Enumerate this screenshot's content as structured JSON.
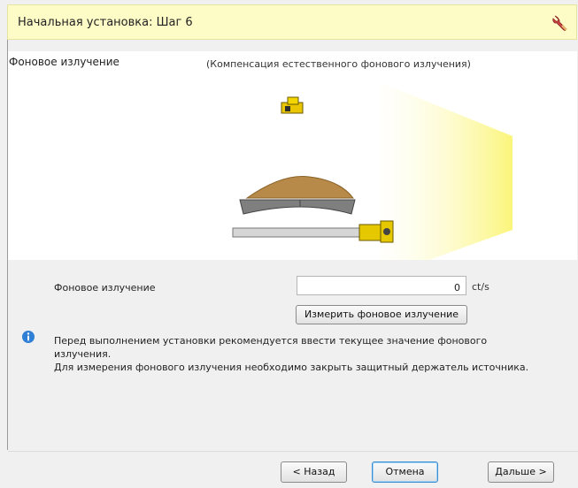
{
  "window": {
    "title": "Начальная установка: Шаг 6"
  },
  "section": {
    "title": "Фоновое излучение",
    "subtitle": "(Компенсация естественного фонового излучения)"
  },
  "form": {
    "label": "Фоновое излучение",
    "value": "0",
    "unit": "ct/s",
    "measure_button": "Измерить фоновое излучение"
  },
  "info": {
    "line1": "Перед выполнением установки рекомендуется ввести текущее значение фонового",
    "line2": "излучения.",
    "line3": "Для измерения фонового излучения необходимо закрыть защитный держатель источника."
  },
  "footer": {
    "back": "< Назад",
    "cancel": "Отмена",
    "next": "Дальше >"
  },
  "colors": {
    "header_bg": "#fdfbc6",
    "accent_yellow": "#f2e400",
    "cancel_border": "#3c8cd0"
  },
  "icons": {
    "header": "wrench-icon",
    "info": "info-icon",
    "detector": "detector-icon",
    "source_holder": "source-holder-icon"
  }
}
